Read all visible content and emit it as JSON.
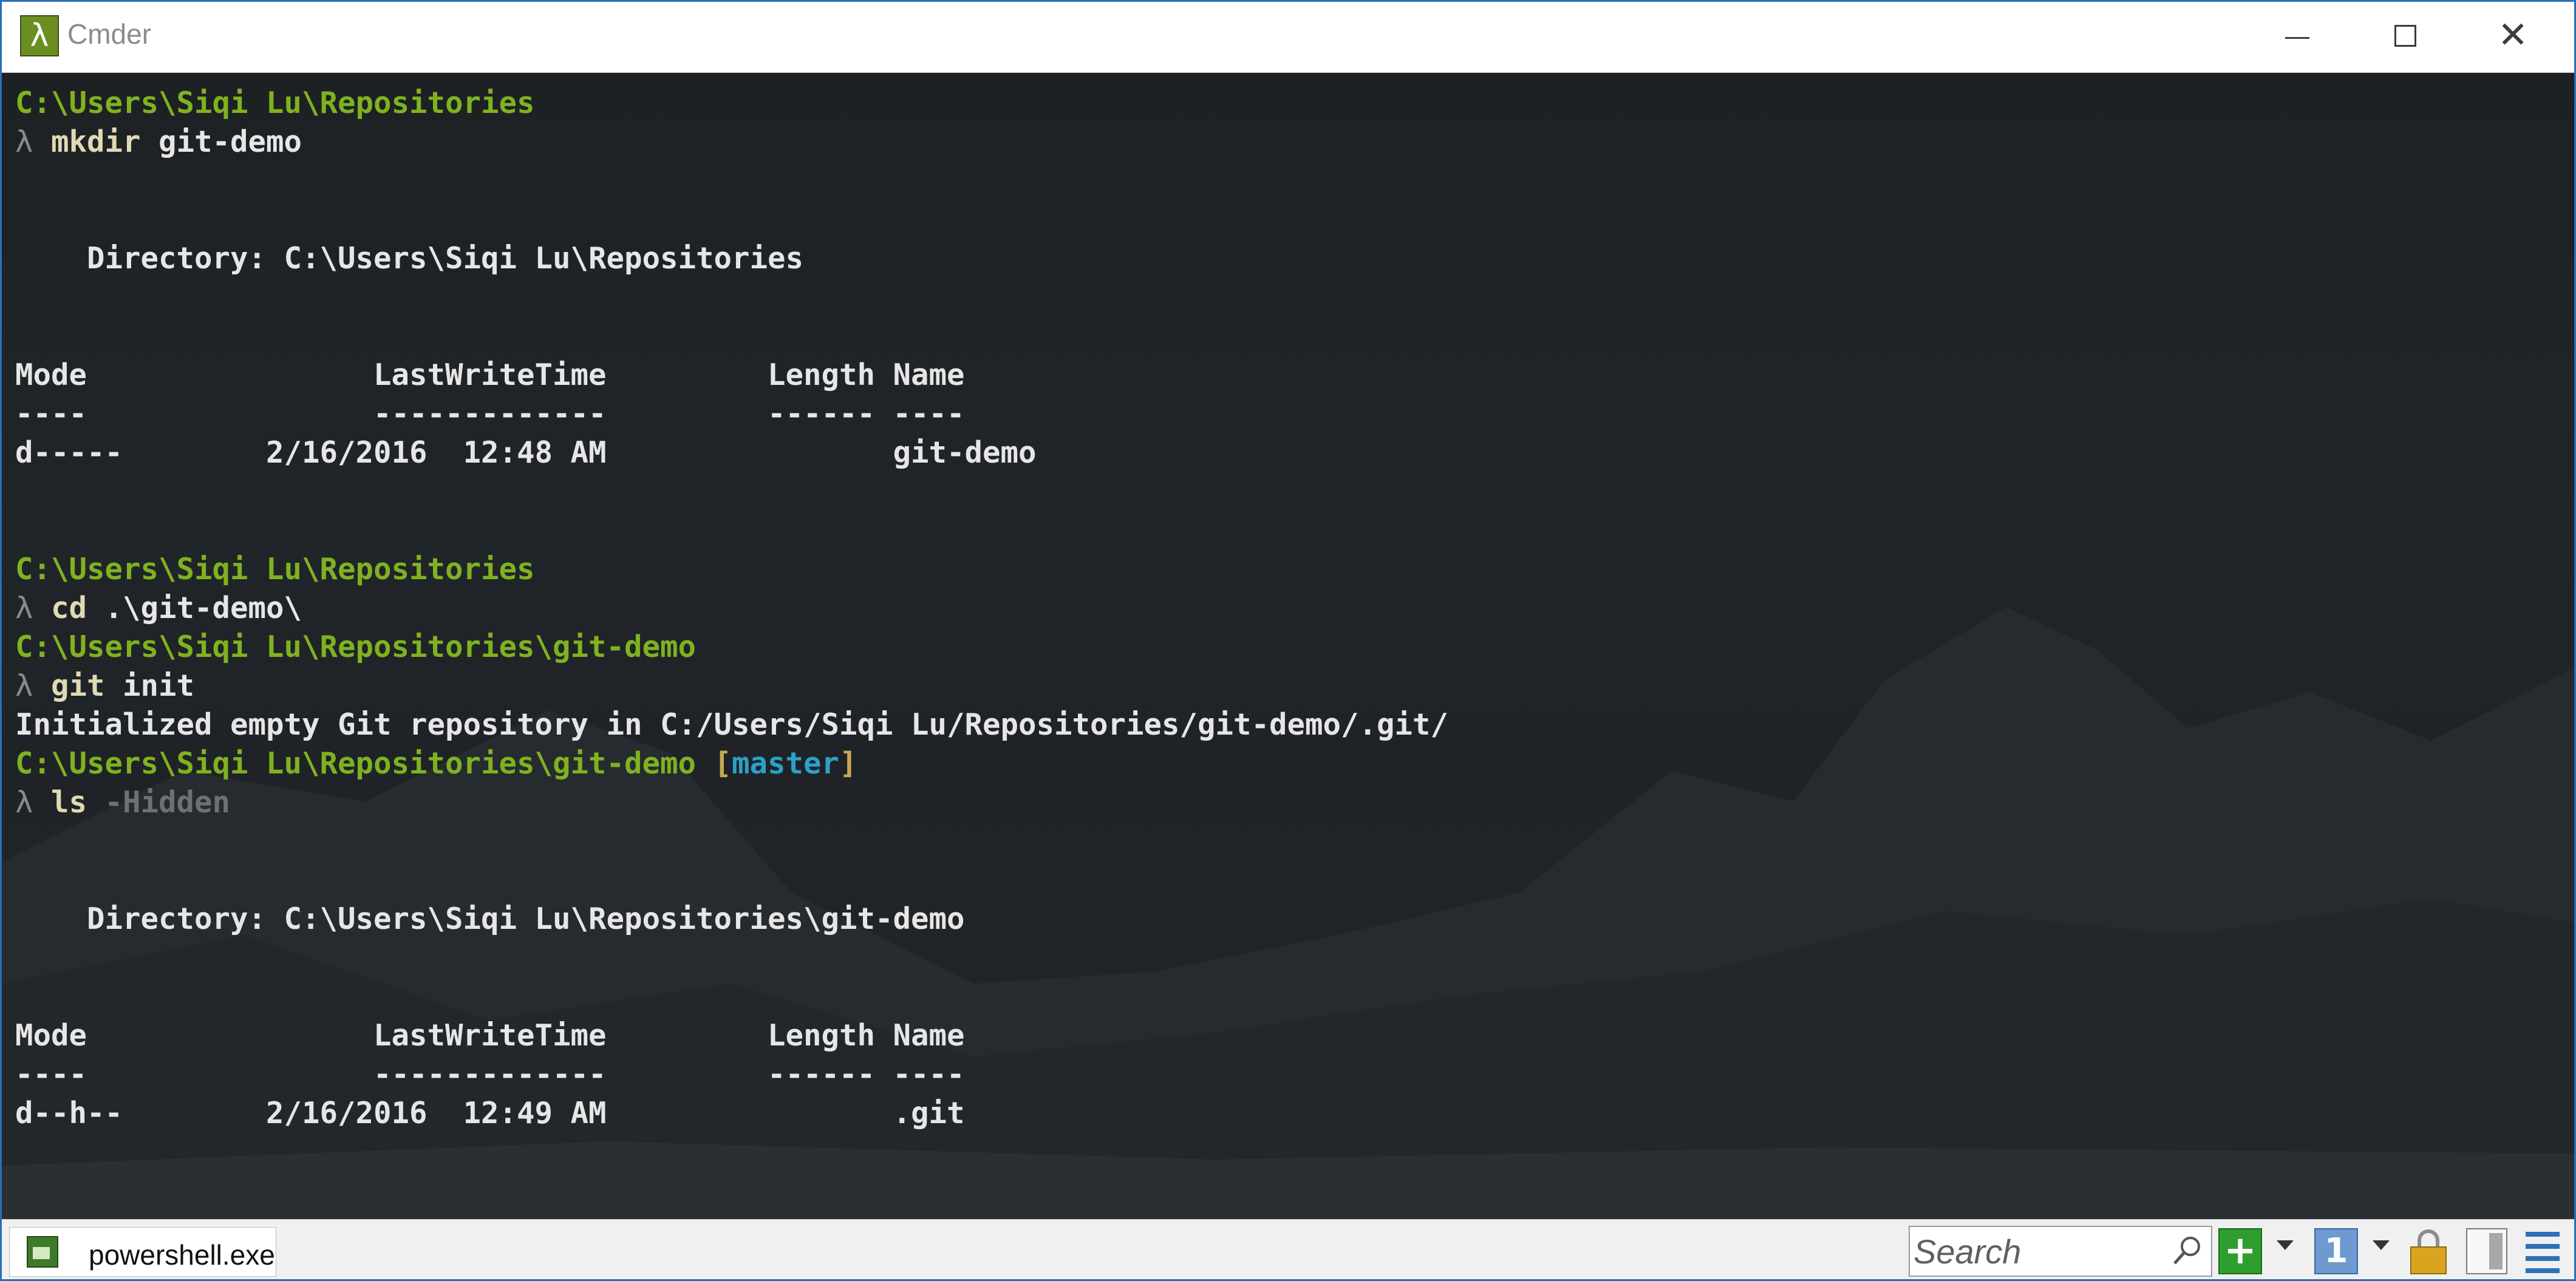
{
  "window": {
    "title": "Cmder",
    "app_icon_glyph": "λ",
    "controls": {
      "minimize": "minimize-icon",
      "maximize": "maximize-icon",
      "close": "close-icon"
    }
  },
  "console": {
    "lines": [
      {
        "segments": [
          {
            "cls": "path",
            "text": "C:\\Users\\Siqi Lu\\Repositories"
          }
        ]
      },
      {
        "segments": [
          {
            "cls": "lambda",
            "text": "λ "
          },
          {
            "cls": "cmd",
            "text": "mkdir"
          },
          {
            "cls": "arg",
            "text": " git-demo"
          }
        ]
      },
      {
        "segments": []
      },
      {
        "segments": []
      },
      {
        "segments": [
          {
            "cls": "out",
            "text": "    Directory: C:\\Users\\Siqi Lu\\Repositories"
          }
        ]
      },
      {
        "segments": []
      },
      {
        "segments": []
      },
      {
        "segments": [
          {
            "cls": "out",
            "text": "Mode                LastWriteTime         Length Name"
          }
        ]
      },
      {
        "segments": [
          {
            "cls": "out",
            "text": "----                -------------         ------ ----"
          }
        ]
      },
      {
        "segments": [
          {
            "cls": "out",
            "text": "d-----        2/16/2016  12:48 AM                git-demo"
          }
        ]
      },
      {
        "segments": []
      },
      {
        "segments": []
      },
      {
        "segments": [
          {
            "cls": "path",
            "text": "C:\\Users\\Siqi Lu\\Repositories"
          }
        ]
      },
      {
        "segments": [
          {
            "cls": "lambda",
            "text": "λ "
          },
          {
            "cls": "cmd",
            "text": "cd"
          },
          {
            "cls": "arg",
            "text": " .\\git-demo\\"
          }
        ]
      },
      {
        "segments": [
          {
            "cls": "path",
            "text": "C:\\Users\\Siqi Lu\\Repositories\\git-demo"
          }
        ]
      },
      {
        "segments": [
          {
            "cls": "lambda",
            "text": "λ "
          },
          {
            "cls": "cmd",
            "text": "git"
          },
          {
            "cls": "arg",
            "text": " init"
          }
        ]
      },
      {
        "segments": [
          {
            "cls": "out",
            "text": "Initialized empty Git repository in C:/Users/Siqi Lu/Repositories/git-demo/.git/"
          }
        ]
      },
      {
        "segments": [
          {
            "cls": "path",
            "text": "C:\\Users\\Siqi Lu\\Repositories\\git-demo "
          },
          {
            "cls": "branch-bracket",
            "text": "["
          },
          {
            "cls": "branch",
            "text": "master"
          },
          {
            "cls": "branch-bracket",
            "text": "]"
          }
        ]
      },
      {
        "segments": [
          {
            "cls": "lambda",
            "text": "λ "
          },
          {
            "cls": "cmd",
            "text": "ls"
          },
          {
            "cls": "arg-dim",
            "text": " -Hidden"
          }
        ]
      },
      {
        "segments": []
      },
      {
        "segments": []
      },
      {
        "segments": [
          {
            "cls": "out",
            "text": "    Directory: C:\\Users\\Siqi Lu\\Repositories\\git-demo"
          }
        ]
      },
      {
        "segments": []
      },
      {
        "segments": []
      },
      {
        "segments": [
          {
            "cls": "out",
            "text": "Mode                LastWriteTime         Length Name"
          }
        ]
      },
      {
        "segments": [
          {
            "cls": "out",
            "text": "----                -------------         ------ ----"
          }
        ]
      },
      {
        "segments": [
          {
            "cls": "out",
            "text": "d--h--        2/16/2016  12:49 AM                .git"
          }
        ]
      }
    ]
  },
  "statusbar": {
    "tab_label": "powershell.exe",
    "tab_icon": "powershell-icon",
    "search_placeholder": "Search",
    "search_icon": "search-icon",
    "add_icon": "plus-icon",
    "add_glyph": "+",
    "console_icon": "console-icon",
    "console_glyph": "1",
    "lock_icon": "lock-icon",
    "panel_icon": "panel-icon",
    "menu_icon": "hamburger-menu-icon"
  },
  "colors": {
    "path": "#7fb21f",
    "branch": "#2aa2c8",
    "branch_bracket": "#c9a850",
    "command": "#e0dab4",
    "output": "#e6e6e6",
    "window_border": "#2b6fb4"
  }
}
